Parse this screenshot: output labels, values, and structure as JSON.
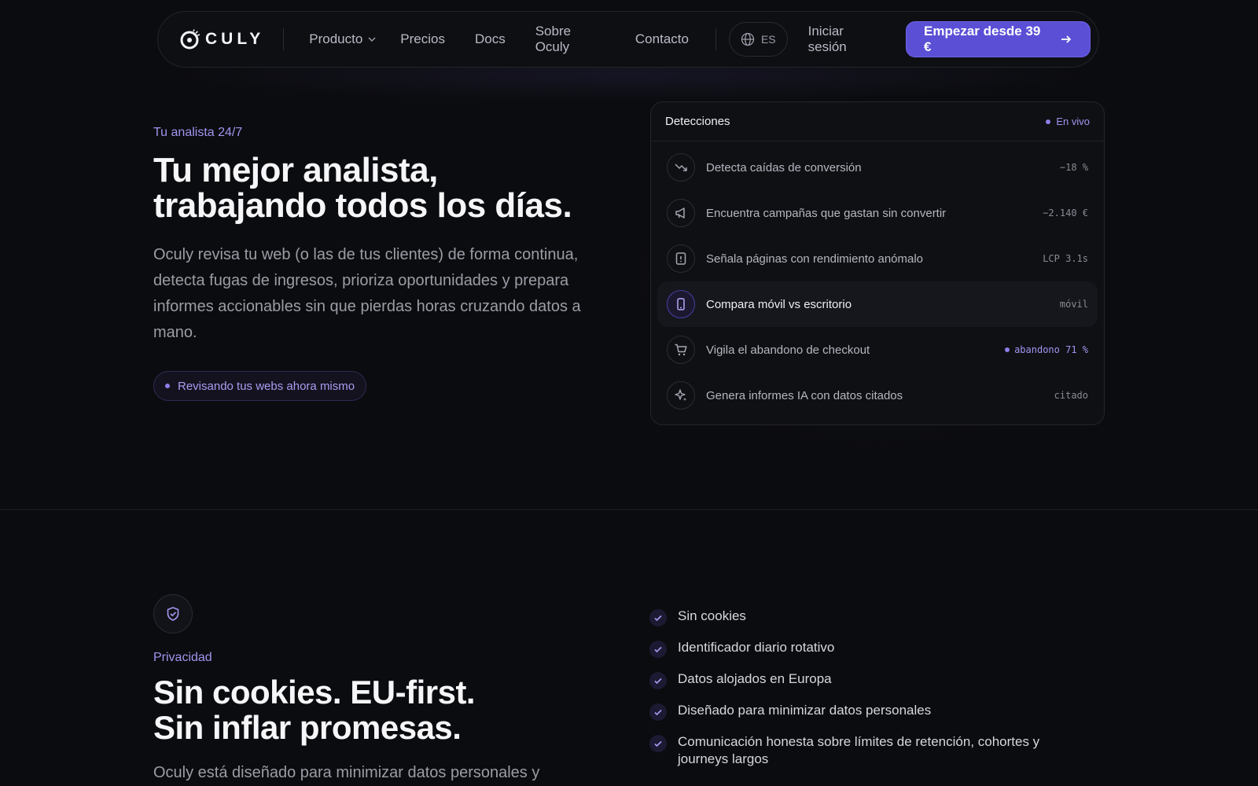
{
  "nav": {
    "logo_text": "CULY",
    "links": [
      "Producto",
      "Precios",
      "Docs",
      "Sobre Oculy",
      "Contacto"
    ],
    "lang": "ES",
    "login": "Iniciar sesión",
    "cta": "Empezar desde 39 €"
  },
  "hero": {
    "eyebrow": "Tu analista 24/7",
    "title_line1": "Tu mejor analista,",
    "title_line2": "trabajando todos los días.",
    "description": "Oculy revisa tu web (o las de tus clientes) de forma continua, detecta fugas de ingresos, prioriza oportunidades y prepara informes accionables sin que pierdas horas cruzando datos a mano.",
    "status": "Revisando tus webs ahora mismo"
  },
  "panel": {
    "title": "Detecciones",
    "live": "En vivo",
    "rows": [
      {
        "icon": "trending-down-icon",
        "label": "Detecta caídas de conversión",
        "value": "−18 %"
      },
      {
        "icon": "megaphone-icon",
        "label": "Encuentra campañas que gastan sin convertir",
        "value": "−2.140 €"
      },
      {
        "icon": "alert-file-icon",
        "label": "Señala páginas con rendimiento anómalo",
        "value": "LCP 3.1s"
      },
      {
        "icon": "mobile-icon",
        "label": "Compara móvil vs escritorio",
        "value": "móvil"
      },
      {
        "icon": "cart-icon",
        "label": "Vigila el abandono de checkout",
        "value": "abandono 71 %"
      },
      {
        "icon": "sparkles-icon",
        "label": "Genera informes IA con datos citados",
        "value": "citado"
      }
    ]
  },
  "privacy": {
    "eyebrow": "Privacidad",
    "title_line1": "Sin cookies. EU-first.",
    "title_line2": "Sin inflar promesas.",
    "description": "Oculy está diseñado para minimizar datos personales y",
    "checks": [
      "Sin cookies",
      "Identificador diario rotativo",
      "Datos alojados en Europa",
      "Diseñado para minimizar datos personales",
      "Comunicación honesta sobre límites de retención, cohortes y journeys largos"
    ]
  },
  "colors": {
    "accent": "#5b4fd6",
    "accent_text": "#a394f0",
    "background": "#0b0c0f"
  }
}
